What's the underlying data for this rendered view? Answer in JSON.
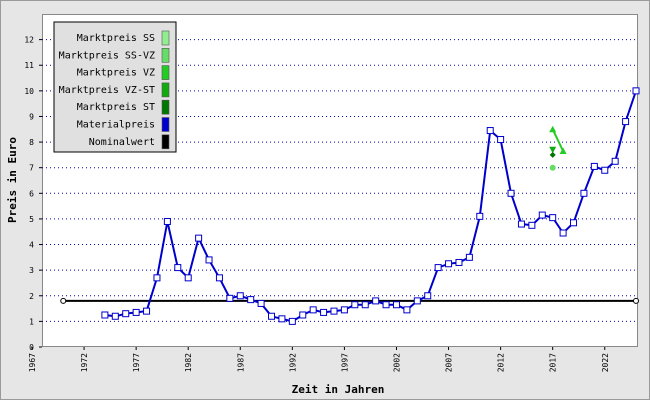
{
  "chart_data": {
    "type": "line",
    "title": "",
    "xlabel": "Zeit in Jahren",
    "ylabel": "Preis in Euro",
    "xlim": [
      1967,
      2025
    ],
    "ylim": [
      0,
      13
    ],
    "x_ticks": [
      1967,
      1972,
      1977,
      1982,
      1987,
      1992,
      1997,
      2002,
      2007,
      2012,
      2017,
      2022
    ],
    "y_ticks": [
      0,
      1,
      2,
      3,
      4,
      5,
      6,
      7,
      8,
      9,
      10,
      11,
      12
    ],
    "grid": "horizontal dotted",
    "legend_position": "top-left",
    "series": [
      {
        "name": "Marktpreis SS",
        "color": "#90ee90",
        "points": []
      },
      {
        "name": "Marktpreis SS-VZ",
        "color": "#66dd66",
        "points": [
          [
            2017,
            7.0
          ]
        ]
      },
      {
        "name": "Marktpreis VZ",
        "color": "#22cc22",
        "points": [
          [
            2017,
            8.5
          ],
          [
            2018,
            7.65
          ]
        ]
      },
      {
        "name": "Marktpreis VZ-ST",
        "color": "#11aa11",
        "points": [
          [
            2017,
            7.7
          ]
        ]
      },
      {
        "name": "Marktpreis ST",
        "color": "#007700",
        "points": [
          [
            2017,
            7.5
          ]
        ]
      },
      {
        "name": "Materialpreis",
        "color": "#0000cc",
        "points": [
          [
            1974,
            1.25
          ],
          [
            1975,
            1.2
          ],
          [
            1976,
            1.3
          ],
          [
            1977,
            1.35
          ],
          [
            1978,
            1.4
          ],
          [
            1979,
            2.7
          ],
          [
            1980,
            4.9
          ],
          [
            1981,
            3.1
          ],
          [
            1982,
            2.7
          ],
          [
            1983,
            4.25
          ],
          [
            1984,
            3.4
          ],
          [
            1985,
            2.7
          ],
          [
            1986,
            1.9
          ],
          [
            1987,
            2.0
          ],
          [
            1988,
            1.85
          ],
          [
            1989,
            1.7
          ],
          [
            1990,
            1.2
          ],
          [
            1991,
            1.1
          ],
          [
            1992,
            1.0
          ],
          [
            1993,
            1.25
          ],
          [
            1994,
            1.45
          ],
          [
            1995,
            1.35
          ],
          [
            1996,
            1.4
          ],
          [
            1997,
            1.45
          ],
          [
            1998,
            1.65
          ],
          [
            1999,
            1.65
          ],
          [
            2000,
            1.8
          ],
          [
            2001,
            1.65
          ],
          [
            2002,
            1.65
          ],
          [
            2003,
            1.45
          ],
          [
            2004,
            1.8
          ],
          [
            2005,
            2.0
          ],
          [
            2006,
            3.1
          ],
          [
            2007,
            3.25
          ],
          [
            2008,
            3.3
          ],
          [
            2009,
            3.5
          ],
          [
            2010,
            5.1
          ],
          [
            2011,
            8.45
          ],
          [
            2012,
            8.1
          ],
          [
            2013,
            6.0
          ],
          [
            2014,
            4.8
          ],
          [
            2015,
            4.75
          ],
          [
            2016,
            5.15
          ],
          [
            2017,
            5.05
          ],
          [
            2018,
            4.45
          ],
          [
            2019,
            4.85
          ],
          [
            2020,
            6.0
          ],
          [
            2021,
            7.05
          ],
          [
            2022,
            6.9
          ],
          [
            2023,
            7.25
          ],
          [
            2024,
            8.8
          ],
          [
            2025,
            10.0
          ]
        ]
      },
      {
        "name": "Nominalwert",
        "color": "#000000",
        "points": [
          [
            1970,
            1.8
          ],
          [
            2025,
            1.8
          ]
        ]
      }
    ]
  }
}
